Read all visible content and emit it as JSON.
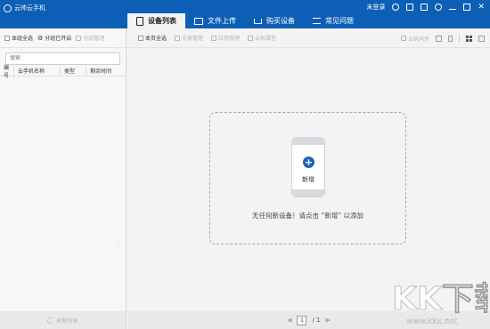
{
  "app": {
    "title": "云帅云手机"
  },
  "header": {
    "login_label": "未登录",
    "tabs": [
      {
        "label": "设备列表",
        "active": true,
        "icon": "phone-icon"
      },
      {
        "label": "文件上传",
        "active": false,
        "icon": "folder-icon"
      },
      {
        "label": "购买设备",
        "active": false,
        "icon": "cart-icon"
      },
      {
        "label": "常见问题",
        "active": false,
        "icon": "list-icon"
      }
    ]
  },
  "left_panel": {
    "toolbar": {
      "select_group": "本组全选",
      "group_opened": "分组已开启",
      "group_manage": "分组管理"
    },
    "search_placeholder": "搜索",
    "table_headers": [
      "编号",
      "云手机名称",
      "类型",
      "剩余时间"
    ],
    "refresh_label": "刷新列表"
  },
  "main": {
    "toolbar": {
      "select_page": "本页全选",
      "device_manage": "设备管理",
      "app_manage": "应用管理",
      "cloud_attr": "云机属性",
      "cloud_sync": "云机同步"
    },
    "empty": {
      "add_label": "新增",
      "message": "无任何新设备！请点击 “新增” 以添加"
    },
    "pagination": {
      "current": "1",
      "total": "/ 1"
    }
  },
  "watermark": {
    "brand": "KK下载",
    "url": "www.kkx.net"
  },
  "colors": {
    "titlebar": "#0d5fb6",
    "accent": "#1e63b7",
    "background": "#f3f3f3"
  }
}
